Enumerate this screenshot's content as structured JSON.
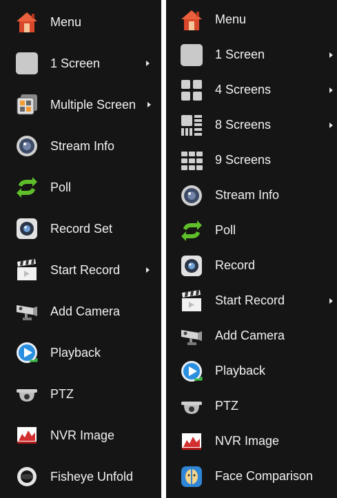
{
  "left_menu": {
    "items": [
      {
        "label": "Menu",
        "icon": "house-icon",
        "submenu": false
      },
      {
        "label": "1 Screen",
        "icon": "single-screen-icon",
        "submenu": true
      },
      {
        "label": "Multiple Screen",
        "icon": "multiple-screen-icon",
        "submenu": true
      },
      {
        "label": "Stream Info",
        "icon": "stream-info-icon",
        "submenu": false
      },
      {
        "label": "Poll",
        "icon": "poll-icon",
        "submenu": false
      },
      {
        "label": "Record Set",
        "icon": "record-set-icon",
        "submenu": false
      },
      {
        "label": "Start Record",
        "icon": "clapperboard-icon",
        "submenu": true
      },
      {
        "label": "Add Camera",
        "icon": "camera-icon",
        "submenu": false
      },
      {
        "label": "Playback",
        "icon": "playback-icon",
        "submenu": false
      },
      {
        "label": "PTZ",
        "icon": "ptz-dome-icon",
        "submenu": false
      },
      {
        "label": "NVR Image",
        "icon": "nvr-image-icon",
        "submenu": false
      },
      {
        "label": "Fisheye Unfold",
        "icon": "fisheye-icon",
        "submenu": false
      }
    ]
  },
  "right_menu": {
    "items": [
      {
        "label": "Menu",
        "icon": "house-icon",
        "submenu": false
      },
      {
        "label": "1 Screen",
        "icon": "single-screen-icon",
        "submenu": true
      },
      {
        "label": "4 Screens",
        "icon": "four-screens-icon",
        "submenu": true
      },
      {
        "label": "8 Screens",
        "icon": "eight-screens-icon",
        "submenu": true
      },
      {
        "label": "9 Screens",
        "icon": "nine-screens-icon",
        "submenu": false
      },
      {
        "label": "Stream Info",
        "icon": "stream-info-icon",
        "submenu": false
      },
      {
        "label": "Poll",
        "icon": "poll-icon",
        "submenu": false
      },
      {
        "label": "Record",
        "icon": "record-icon",
        "submenu": false
      },
      {
        "label": "Start Record",
        "icon": "clapperboard-icon",
        "submenu": true
      },
      {
        "label": "Add Camera",
        "icon": "camera-icon",
        "submenu": false
      },
      {
        "label": "Playback",
        "icon": "playback-icon",
        "submenu": false
      },
      {
        "label": "PTZ",
        "icon": "ptz-dome-icon",
        "submenu": false
      },
      {
        "label": "NVR Image",
        "icon": "nvr-image-icon",
        "submenu": false
      },
      {
        "label": "Face Comparison",
        "icon": "face-comparison-icon",
        "submenu": false
      }
    ]
  },
  "colors": {
    "panel_background": "#151515",
    "text": "#f2f2f2",
    "house_red": "#d9472a",
    "poll_green": "#5fbf2a",
    "playback_blue": "#2b8fe0"
  }
}
